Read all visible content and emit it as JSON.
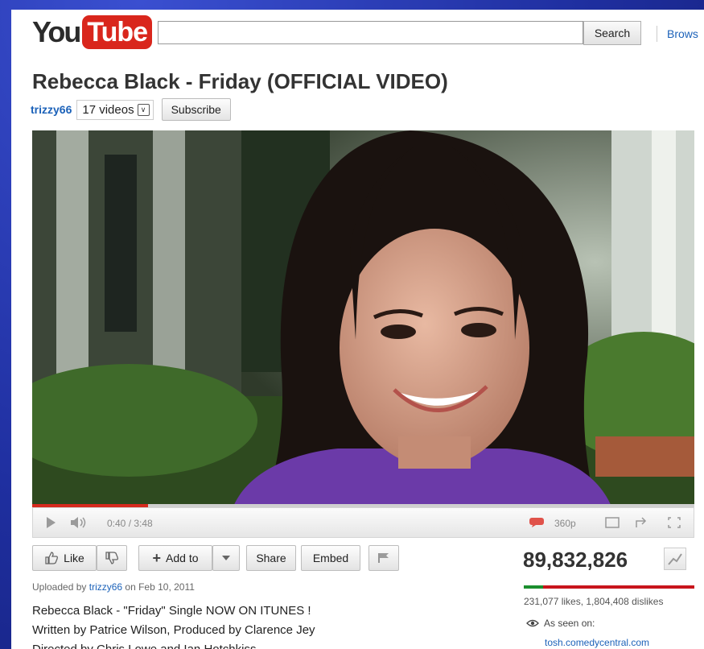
{
  "header": {
    "logo_you": "You",
    "logo_tube": "Tube",
    "search_value": "",
    "search_button": "Search",
    "browse_link": "Brows"
  },
  "video": {
    "title": "Rebecca Black - Friday (OFFICIAL VIDEO)",
    "channel": "trizzy66",
    "videos_count": "17 videos",
    "subscribe_label": "Subscribe",
    "time": "0:40 / 3:48",
    "quality": "360p",
    "progress": 0.175
  },
  "actions": {
    "like": "Like",
    "add_to": "Add to",
    "share": "Share",
    "embed": "Embed"
  },
  "stats": {
    "views": "89,832,826",
    "likes_text": "231,077 likes, 1,804,408 dislikes",
    "like_ratio": 0.113,
    "seen_on_label": "As seen on:",
    "seen_on_link": "tosh.comedycentral.com"
  },
  "upload": {
    "prefix": "Uploaded by",
    "user": "trizzy66",
    "date_text": "on Feb 10, 2011"
  },
  "description": {
    "line1": "Rebecca Black - \"Friday\" Single NOW ON ITUNES !",
    "line2": "Written by Patrice Wilson, Produced by Clarence Jey",
    "line3": "Directed by Chris Lowe and Ian Hotchkiss"
  },
  "colors": {
    "accent_red": "#d62a1e",
    "link_blue": "#1c62b9",
    "like_green": "#1b8f2e",
    "dislike_red": "#c8151c"
  }
}
